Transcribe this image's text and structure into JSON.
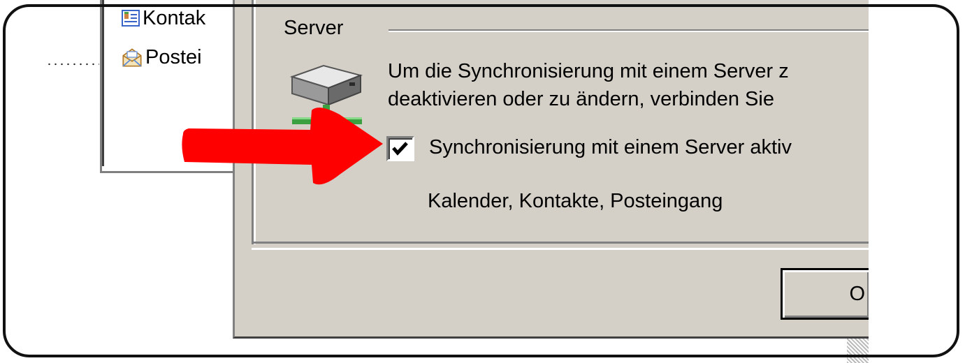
{
  "list": {
    "items": [
      {
        "label": "Kontak",
        "icon": "contacts-card-icon"
      },
      {
        "label": "Postei",
        "icon": "inbox-envelope-icon"
      }
    ]
  },
  "group": {
    "title": "Server",
    "description_line1": "Um die Synchronisierung mit einem Server z",
    "description_line2": "deaktivieren oder zu ändern, verbinden Sie"
  },
  "sync_checkbox": {
    "label": "Synchronisierung mit einem Server aktiv",
    "checked": true
  },
  "sync_services": "Kalender, Kontakte, Posteingang",
  "buttons": {
    "ok_label": "O"
  },
  "annotation": {
    "arrow_color": "#ff0000",
    "icon": "red-arrow-icon"
  },
  "colors": {
    "dialog_bg": "#d4d0c8",
    "frame_border": "#111111"
  }
}
